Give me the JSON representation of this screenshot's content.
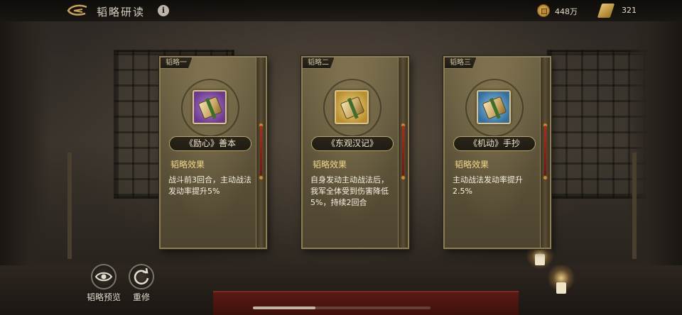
{
  "header": {
    "title": "韬略研读",
    "info_icon": "info-icon",
    "back_icon": "back-arrow-icon"
  },
  "resources": {
    "coins": "448万",
    "scrolls": "321"
  },
  "cards": [
    {
      "tag": "韬略一",
      "item_name": "《励心》善本",
      "effect_label": "韬略效果",
      "effect_text": "战斗前3回合，主动战法发动率提升5%",
      "rarity_color": "#6b3a8c"
    },
    {
      "tag": "韬略二",
      "item_name": "《东观汉记》",
      "effect_label": "韬略效果",
      "effect_text": "自身发动主动战法后，我军全体受到伤害降低5%，持续2回合",
      "rarity_color": "#b98f2f"
    },
    {
      "tag": "韬略三",
      "item_name": "《机动》手抄",
      "effect_label": "韬略效果",
      "effect_text": "主动战法发动率提升2.5%",
      "rarity_color": "#356f9c"
    }
  ],
  "actions": {
    "preview_label": "韬略预览",
    "preview_icon": "eye-icon",
    "relearn_label": "重修",
    "relearn_icon": "refresh-icon"
  },
  "colors": {
    "effect_label": "#f1d78a",
    "card_border": "#8c7d56"
  },
  "scroll_position": 0.35
}
